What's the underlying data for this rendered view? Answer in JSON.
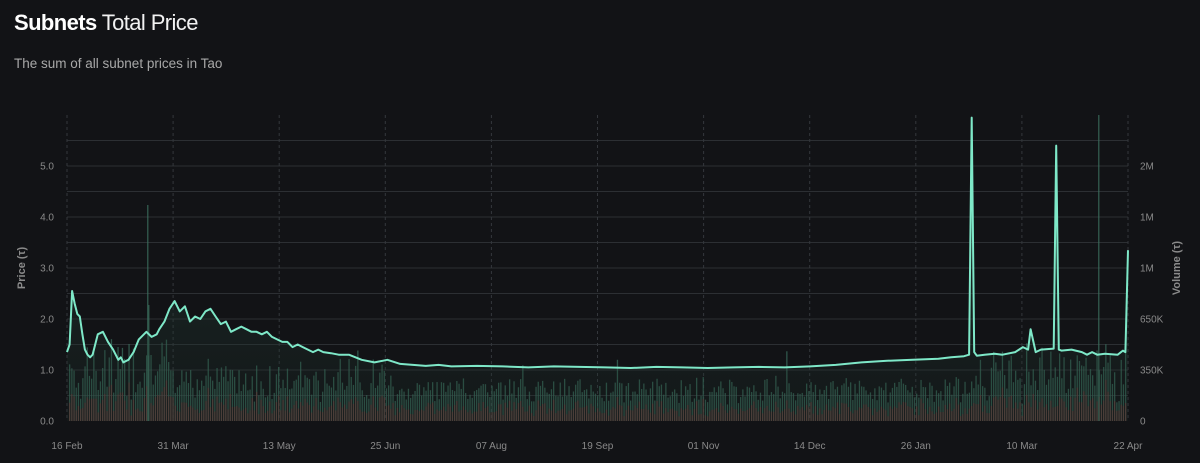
{
  "header": {
    "title_strong": "Subnets",
    "title_light": "Total Price",
    "subtitle": "The sum of all subnet prices in Tao"
  },
  "colors": {
    "background": "#121316",
    "line": "#7ee8c8",
    "volume_green": "#3a6e5c",
    "volume_red": "#7a3434",
    "grid": "#2c2f33"
  },
  "chart_data": {
    "type": "line",
    "title": "Subnets Total Price",
    "subtitle": "The sum of all subnet prices in Tao",
    "ylabel": "Price (τ)",
    "y2label": "Volume (τ)",
    "ylim": [
      0,
      6.0
    ],
    "y_ticks": [
      "0.0",
      "1.0",
      "2.0",
      "3.0",
      "4.0",
      "5.0"
    ],
    "y2_ticks": [
      "0",
      "350K",
      "650K",
      "1M",
      "1M",
      "2M"
    ],
    "x_ticks": [
      "16 Feb",
      "31 Mar",
      "13 May",
      "25 Jun",
      "07 Aug",
      "19 Sep",
      "01 Nov",
      "14 Dec",
      "26 Jan",
      "10 Mar",
      "22 Apr"
    ],
    "grid": true,
    "series": [
      {
        "name": "Price",
        "x_day": [
          0,
          1,
          2,
          3,
          4,
          5,
          6,
          7,
          8,
          9,
          10,
          12,
          14,
          16,
          18,
          19,
          20,
          21,
          22,
          24,
          26,
          28,
          29,
          31,
          33,
          35,
          36,
          38,
          40,
          42,
          44,
          46,
          48,
          50,
          52,
          54,
          56,
          58,
          60,
          62,
          64,
          66,
          68,
          70,
          72,
          74,
          76,
          78,
          80,
          82,
          84,
          86,
          88,
          90,
          92,
          94,
          96,
          98,
          100,
          103,
          106,
          110,
          115,
          120,
          125,
          130,
          135,
          140,
          145,
          150,
          160,
          170,
          180,
          190,
          200,
          210,
          220,
          230,
          240,
          250,
          260,
          270,
          280,
          290,
          300,
          310,
          320,
          330,
          340,
          345,
          350,
          352,
          353,
          354,
          355,
          358,
          362,
          365,
          370,
          373,
          375,
          376,
          378,
          380,
          385,
          386,
          387,
          388,
          392,
          396,
          398,
          400,
          402,
          405,
          410,
          412,
          413,
          414
        ],
        "values": [
          1.35,
          1.5,
          2.55,
          2.3,
          2.1,
          2.05,
          1.7,
          1.4,
          1.3,
          1.25,
          1.3,
          1.7,
          1.75,
          1.55,
          1.4,
          1.3,
          1.2,
          1.25,
          1.15,
          1.2,
          1.35,
          1.6,
          1.65,
          1.75,
          1.65,
          1.7,
          1.8,
          1.95,
          2.2,
          2.35,
          2.15,
          2.25,
          1.95,
          2.05,
          2.0,
          2.15,
          2.2,
          2.05,
          1.9,
          1.95,
          1.75,
          1.8,
          1.85,
          1.8,
          1.75,
          1.75,
          1.7,
          1.75,
          1.65,
          1.6,
          1.55,
          1.55,
          1.45,
          1.5,
          1.45,
          1.4,
          1.35,
          1.4,
          1.35,
          1.33,
          1.3,
          1.3,
          1.2,
          1.15,
          1.2,
          1.12,
          1.1,
          1.08,
          1.1,
          1.07,
          1.08,
          1.07,
          1.05,
          1.07,
          1.06,
          1.05,
          1.04,
          1.06,
          1.05,
          1.04,
          1.05,
          1.06,
          1.05,
          1.07,
          1.1,
          1.15,
          1.18,
          1.2,
          1.22,
          1.25,
          1.27,
          1.3,
          5.95,
          1.35,
          1.28,
          1.3,
          1.32,
          1.3,
          1.35,
          1.45,
          1.4,
          1.8,
          1.35,
          1.4,
          1.42,
          5.4,
          1.4,
          1.38,
          1.4,
          1.35,
          1.3,
          1.35,
          1.3,
          1.32,
          1.3,
          1.38,
          1.35,
          3.35
        ]
      }
    ]
  }
}
